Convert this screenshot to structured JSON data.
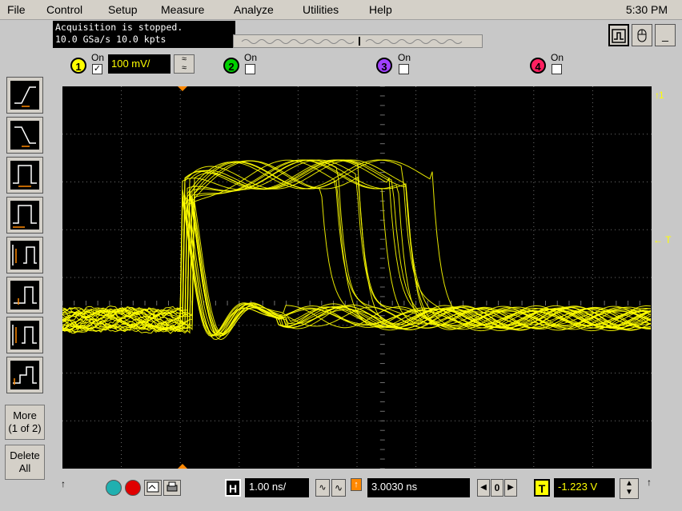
{
  "menu": {
    "items": [
      "File",
      "Control",
      "Setup",
      "Measure",
      "Analyze",
      "Utilities",
      "Help"
    ],
    "clock": "5:30 PM"
  },
  "status": {
    "line1": "Acquisition is stopped.",
    "line2": "10.0 GSa/s  10.0 kpts"
  },
  "toolbar": {
    "scope_icon": "waveform-window-icon",
    "mouse_icon": "mouse-icon",
    "minimize": "_"
  },
  "channels": [
    {
      "num": "1",
      "on_label": "On",
      "checked": true,
      "color": "#ffff00"
    },
    {
      "num": "2",
      "on_label": "On",
      "checked": false,
      "color": "#00d000"
    },
    {
      "num": "3",
      "on_label": "On",
      "checked": false,
      "color": "#a040ff"
    },
    {
      "num": "4",
      "on_label": "On",
      "checked": false,
      "color": "#ff2060"
    }
  ],
  "channel1_scale": "100 mV/",
  "left_panel": {
    "more_label_1": "More",
    "more_label_2": "(1 of 2)",
    "delete_label_1": "Delete",
    "delete_label_2": "All"
  },
  "screen": {
    "trigger_marker": "T",
    "ground_marker": "1"
  },
  "bottom": {
    "horizontal_label": "H",
    "time_scale": "1.00 ns/",
    "delay": "3.0030 ns",
    "zero_label": "0",
    "trigger_label": "T",
    "trigger_level": "-1.223 V"
  },
  "colors": {
    "trace": "#ffff00",
    "screen_bg": "#000000",
    "grid": "#707070",
    "trigger_marker": "#ff8800"
  }
}
